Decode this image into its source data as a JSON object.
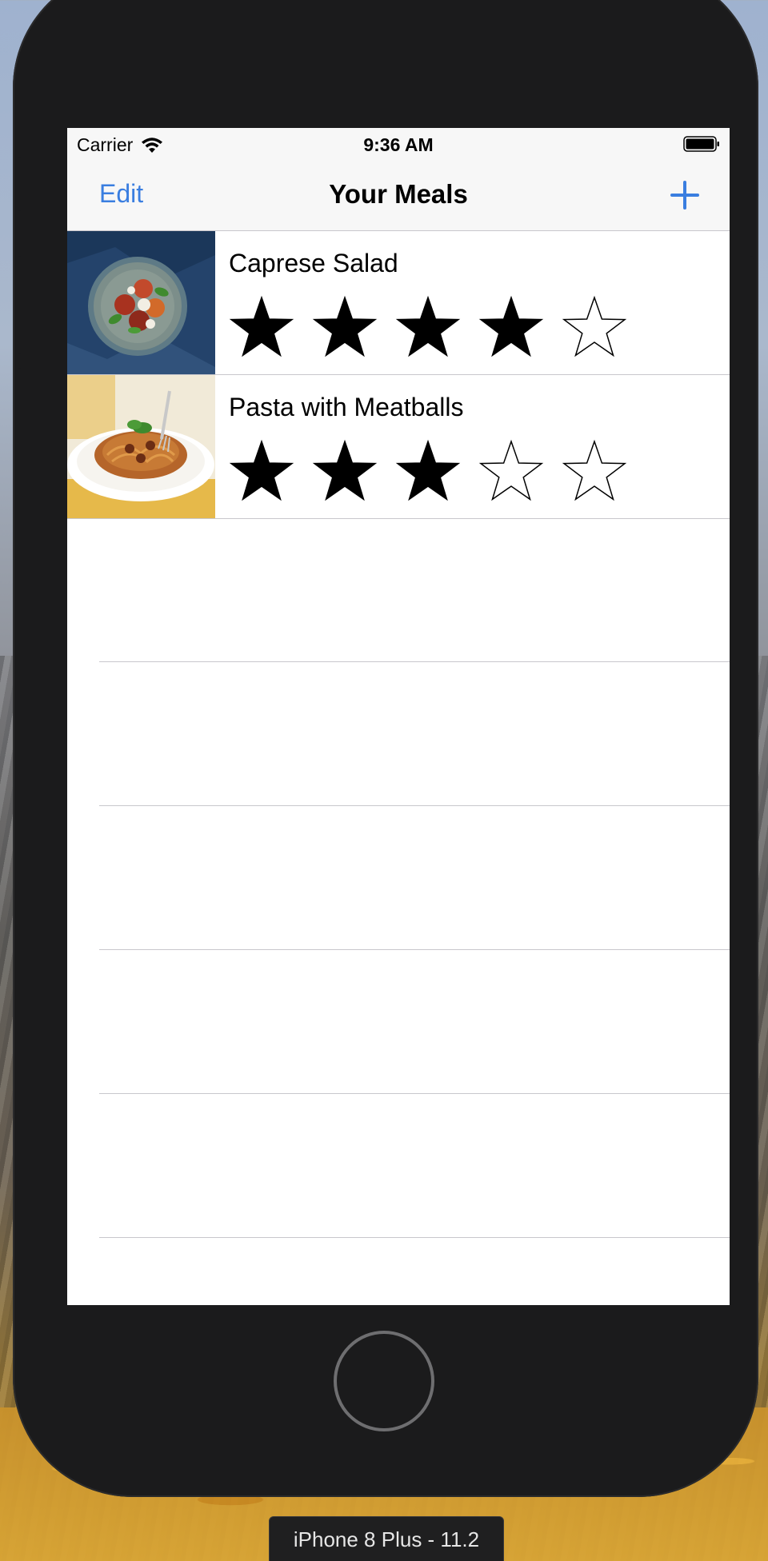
{
  "status_bar": {
    "carrier": "Carrier",
    "time": "9:36 AM"
  },
  "nav": {
    "edit_label": "Edit",
    "title": "Your Meals",
    "add_icon": "plus-icon"
  },
  "meals": [
    {
      "name": "Caprese Salad",
      "rating": 4,
      "max_rating": 5
    },
    {
      "name": "Pasta with Meatballs",
      "rating": 3,
      "max_rating": 5
    }
  ],
  "device": {
    "label": "iPhone 8 Plus - 11.2"
  },
  "colors": {
    "tint": "#3a7ee0",
    "bar_background": "#f7f7f7",
    "separator": "#c8c7cc"
  }
}
